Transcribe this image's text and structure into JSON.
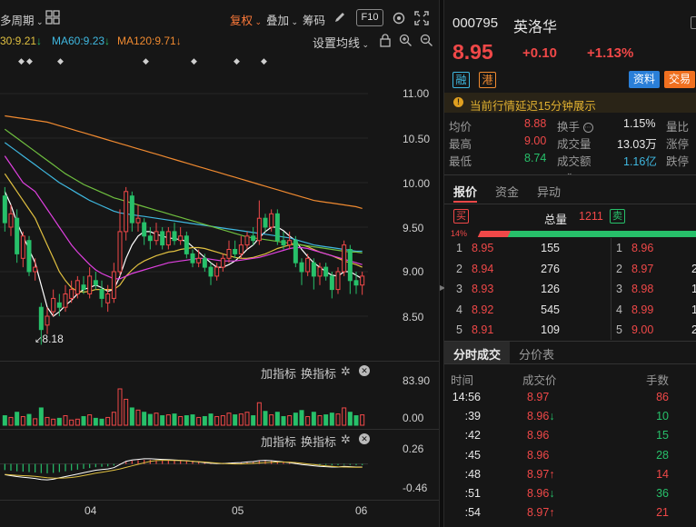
{
  "toolbar": {
    "period_label": "多周期",
    "fuquan_label": "复权",
    "overlay_label": "叠加",
    "chips_label": "筹码",
    "f10_label": "F10"
  },
  "ma_legend": [
    {
      "label": "30:9.21",
      "arrow": "↓",
      "color": "#e0c040"
    },
    {
      "label": "MA60:9.23",
      "arrow": "↓",
      "color": "#3fb8e0"
    },
    {
      "label": "MA120:9.71",
      "arrow": "↓",
      "color": "#f08a30"
    }
  ],
  "set_ma_label": "设置均线",
  "price_axis": [
    "11.00",
    "10.50",
    "10.00",
    "9.50",
    "9.00",
    "8.50"
  ],
  "low_marker": "8.18",
  "event_markers": [
    "◆",
    "◆",
    "◆",
    "◆",
    "◆",
    "◆",
    "◆"
  ],
  "volume_panel": {
    "add_label": "加指标",
    "swap_label": "换指标",
    "axis_top": "83.90",
    "axis_zero": "0.00"
  },
  "macd_panel": {
    "add_label": "加指标",
    "swap_label": "换指标",
    "axis_top": "0.26",
    "axis_bottom": "-0.46"
  },
  "date_axis": [
    "04",
    "05",
    "06"
  ],
  "stock": {
    "code": "000795",
    "name": "英洛华",
    "price": "8.95",
    "change": "+0.10",
    "change_pct": "+1.13%",
    "tag_rong": "融",
    "tag_gang": "港",
    "info_button": "资料",
    "trade_button": "交易",
    "notice": "当前行情延迟15分钟展示"
  },
  "stats": [
    {
      "label": "均价",
      "value": "8.88",
      "value_color": "red",
      "label2": "换手",
      "value2": "1.15%",
      "label3": "量比"
    },
    {
      "label": "最高",
      "value": "9.00",
      "value_color": "red",
      "label2": "成交量",
      "value2": "13.03万",
      "label3": "涨停"
    },
    {
      "label": "最低",
      "value": "8.74",
      "value_color": "green",
      "label2": "成交额",
      "value2": "1.16亿",
      "label3": "跌停"
    }
  ],
  "quote_tabs": [
    "报价",
    "资金",
    "异动"
  ],
  "orderbook": {
    "buy_tag": "买",
    "sell_tag": "卖",
    "total_label": "总量",
    "total_value": "1211",
    "buy_pct": "14%",
    "buy_ratio": 0.14,
    "bids": [
      {
        "level": "1",
        "price": "8.95",
        "volume": "155"
      },
      {
        "level": "2",
        "price": "8.94",
        "volume": "276"
      },
      {
        "level": "3",
        "price": "8.93",
        "volume": "126"
      },
      {
        "level": "4",
        "price": "8.92",
        "volume": "545"
      },
      {
        "level": "5",
        "price": "8.91",
        "volume": "109"
      }
    ],
    "asks": [
      {
        "level": "1",
        "price": "8.96",
        "volume": ""
      },
      {
        "level": "2",
        "price": "8.97",
        "volume": "2"
      },
      {
        "level": "3",
        "price": "8.98",
        "volume": "1"
      },
      {
        "level": "4",
        "price": "8.99",
        "volume": "1"
      },
      {
        "level": "5",
        "price": "9.00",
        "volume": "2"
      }
    ]
  },
  "trade_tabs": [
    "分时成交",
    "分价表"
  ],
  "trades_header": {
    "time": "时间",
    "price": "成交价",
    "volume": "手数"
  },
  "trades": [
    {
      "time": "14:56",
      "price": "8.97",
      "arrow": "",
      "volume": "86",
      "vol_color": "red"
    },
    {
      "time": ":39",
      "price": "8.96",
      "arrow": "↓",
      "volume": "10",
      "vol_color": "green"
    },
    {
      "time": ":42",
      "price": "8.96",
      "arrow": "",
      "volume": "15",
      "vol_color": "green"
    },
    {
      "time": ":45",
      "price": "8.96",
      "arrow": "",
      "volume": "28",
      "vol_color": "green"
    },
    {
      "time": ":48",
      "price": "8.97",
      "arrow": "↑",
      "volume": "14",
      "vol_color": "red"
    },
    {
      "time": ":51",
      "price": "8.96",
      "arrow": "↓",
      "volume": "36",
      "vol_color": "green"
    },
    {
      "time": ":54",
      "price": "8.97",
      "arrow": "↑",
      "volume": "21",
      "vol_color": "red"
    }
  ],
  "chart_data": {
    "type": "candlestick",
    "ylim": [
      8.0,
      11.3
    ],
    "candles": [
      [
        9.85,
        9.55,
        9.95,
        9.45
      ],
      [
        9.5,
        9.65,
        9.75,
        9.4
      ],
      [
        9.6,
        9.2,
        9.7,
        9.1
      ],
      [
        9.15,
        9.4,
        9.45,
        9.05
      ],
      [
        9.35,
        9.0,
        9.4,
        8.95
      ],
      [
        9.0,
        9.05,
        9.15,
        8.9
      ],
      [
        8.6,
        8.35,
        8.65,
        8.18
      ],
      [
        8.4,
        8.5,
        8.6,
        8.3
      ],
      [
        8.55,
        8.7,
        8.8,
        8.5
      ],
      [
        8.65,
        8.6,
        8.75,
        8.5
      ],
      [
        8.6,
        8.75,
        8.85,
        8.55
      ],
      [
        8.7,
        8.8,
        8.9,
        8.65
      ],
      [
        8.75,
        8.9,
        8.95,
        8.7
      ],
      [
        8.85,
        8.8,
        8.95,
        8.75
      ],
      [
        8.75,
        8.95,
        9.05,
        8.7
      ],
      [
        8.9,
        8.85,
        9.0,
        8.8
      ],
      [
        8.8,
        8.7,
        8.9,
        8.6
      ],
      [
        8.65,
        8.75,
        8.85,
        8.55
      ],
      [
        8.7,
        9.0,
        9.1,
        8.65
      ],
      [
        9.0,
        9.45,
        9.7,
        8.95
      ],
      [
        9.45,
        9.9,
        9.95,
        9.35
      ],
      [
        9.85,
        9.55,
        9.9,
        9.45
      ],
      [
        9.55,
        9.6,
        9.75,
        9.45
      ],
      [
        9.55,
        9.4,
        9.6,
        9.3
      ],
      [
        9.4,
        9.35,
        9.5,
        9.25
      ],
      [
        9.35,
        9.45,
        9.55,
        9.3
      ],
      [
        9.45,
        9.3,
        9.5,
        9.25
      ],
      [
        9.3,
        9.45,
        9.5,
        9.25
      ],
      [
        9.45,
        9.35,
        9.55,
        9.3
      ],
      [
        9.35,
        9.4,
        9.5,
        9.3
      ],
      [
        9.4,
        9.2,
        9.45,
        9.15
      ],
      [
        9.2,
        9.1,
        9.25,
        9.05
      ],
      [
        9.1,
        9.15,
        9.25,
        9.05
      ],
      [
        9.15,
        9.05,
        9.2,
        9.0
      ],
      [
        9.05,
        8.95,
        9.1,
        8.85
      ],
      [
        8.95,
        9.05,
        9.1,
        8.9
      ],
      [
        9.05,
        9.15,
        9.2,
        9.0
      ],
      [
        9.15,
        9.25,
        9.35,
        9.1
      ],
      [
        9.25,
        9.2,
        9.35,
        9.15
      ],
      [
        9.2,
        9.3,
        9.4,
        9.15
      ],
      [
        9.3,
        9.4,
        9.45,
        9.25
      ],
      [
        9.4,
        9.35,
        9.5,
        9.3
      ],
      [
        9.35,
        9.6,
        9.8,
        9.3
      ],
      [
        9.6,
        9.5,
        9.65,
        9.45
      ],
      [
        9.5,
        9.65,
        9.7,
        9.45
      ],
      [
        9.65,
        9.35,
        9.7,
        9.3
      ],
      [
        9.35,
        9.3,
        9.45,
        9.25
      ],
      [
        9.3,
        9.35,
        9.45,
        9.25
      ],
      [
        9.35,
        9.1,
        9.4,
        9.05
      ],
      [
        9.1,
        9.0,
        9.15,
        8.85
      ],
      [
        9.0,
        9.15,
        9.2,
        8.95
      ],
      [
        9.1,
        8.95,
        9.15,
        8.8
      ],
      [
        8.95,
        9.05,
        9.1,
        8.85
      ],
      [
        9.05,
        8.95,
        9.1,
        8.9
      ],
      [
        8.95,
        8.8,
        9.0,
        8.7
      ],
      [
        8.8,
        9.0,
        9.05,
        8.75
      ],
      [
        9.0,
        9.3,
        9.35,
        8.95
      ],
      [
        9.25,
        8.9,
        9.3,
        8.75
      ],
      [
        8.9,
        8.85,
        9.0,
        8.75
      ],
      [
        8.85,
        8.95,
        9.0,
        8.74
      ]
    ],
    "ma_lines": [
      {
        "color": "#ffffff",
        "values": [
          9.9,
          9.75,
          9.55,
          9.4,
          9.25,
          9.1,
          8.85,
          8.6,
          8.5,
          8.55,
          8.62,
          8.68,
          8.75,
          8.8,
          8.82,
          8.85,
          8.82,
          8.78,
          8.8,
          8.95,
          9.15,
          9.3,
          9.4,
          9.45,
          9.45,
          9.42,
          9.4,
          9.38,
          9.37,
          9.36,
          9.34,
          9.28,
          9.22,
          9.16,
          9.1,
          9.05,
          9.05,
          9.08,
          9.12,
          9.18,
          9.25,
          9.3,
          9.38,
          9.45,
          9.5,
          9.5,
          9.46,
          9.4,
          9.35,
          9.25,
          9.17,
          9.1,
          9.05,
          9.0,
          8.96,
          8.95,
          9.0,
          9.0,
          8.96,
          8.92
        ]
      },
      {
        "color": "#e0c040",
        "values": [
          10.1,
          10.0,
          9.9,
          9.8,
          9.7,
          9.6,
          9.45,
          9.3,
          9.15,
          9.0,
          8.9,
          8.82,
          8.78,
          8.77,
          8.78,
          8.8,
          8.8,
          8.8,
          8.8,
          8.85,
          8.95,
          9.02,
          9.08,
          9.12,
          9.15,
          9.18,
          9.2,
          9.22,
          9.23,
          9.25,
          9.26,
          9.27,
          9.27,
          9.26,
          9.24,
          9.22,
          9.2,
          9.18,
          9.16,
          9.15,
          9.15,
          9.16,
          9.18,
          9.2,
          9.23,
          9.26,
          9.28,
          9.3,
          9.31,
          9.3,
          9.28,
          9.25,
          9.22,
          9.2,
          9.18,
          9.15,
          9.12,
          9.1,
          9.08,
          9.05
        ]
      },
      {
        "color": "#e040e0",
        "values": [
          10.3,
          10.2,
          10.1,
          10.0,
          9.95,
          9.9,
          9.8,
          9.7,
          9.6,
          9.5,
          9.4,
          9.3,
          9.22,
          9.15,
          9.08,
          9.02,
          8.98,
          8.95,
          8.92,
          8.92,
          8.95,
          8.98,
          9.0,
          9.02,
          9.04,
          9.06,
          9.08,
          9.1,
          9.11,
          9.12,
          9.13,
          9.14,
          9.15,
          9.15,
          9.14,
          9.13,
          9.12,
          9.12,
          9.12,
          9.13,
          9.14,
          9.15,
          9.16,
          9.18,
          9.2,
          9.22,
          9.24,
          9.26,
          9.27,
          9.27,
          9.26,
          9.24,
          9.22,
          9.2,
          9.18,
          9.16,
          9.14,
          9.12,
          9.1,
          9.08
        ]
      },
      {
        "color": "#3fb8e0",
        "values": [
          10.45,
          10.4,
          10.35,
          10.3,
          10.25,
          10.2,
          10.15,
          10.1,
          10.05,
          10.0,
          9.96,
          9.92,
          9.88,
          9.84,
          9.8,
          9.77,
          9.74,
          9.71,
          9.68,
          9.66,
          9.65,
          9.64,
          9.63,
          9.62,
          9.61,
          9.6,
          9.59,
          9.58,
          9.57,
          9.56,
          9.55,
          9.54,
          9.53,
          9.52,
          9.51,
          9.5,
          9.49,
          9.48,
          9.47,
          9.46,
          9.45,
          9.44,
          9.43,
          9.42,
          9.41,
          9.4,
          9.39,
          9.38,
          9.36,
          9.34,
          9.32,
          9.3,
          9.29,
          9.28,
          9.27,
          9.26,
          9.25,
          9.24,
          9.23,
          9.23
        ]
      },
      {
        "color": "#6fbf3f",
        "values": [
          10.6,
          10.55,
          10.5,
          10.45,
          10.4,
          10.35,
          10.3,
          10.25,
          10.2,
          10.15,
          10.1,
          10.06,
          10.02,
          9.98,
          9.95,
          9.92,
          9.89,
          9.86,
          9.83,
          9.81,
          9.79,
          9.77,
          9.75,
          9.73,
          9.71,
          9.69,
          9.67,
          9.65,
          9.63,
          9.61,
          9.59,
          9.57,
          9.55,
          9.53,
          9.51,
          9.49,
          9.47,
          9.45,
          9.43,
          9.41,
          9.39,
          9.38,
          9.37,
          9.36,
          9.35,
          9.34,
          9.33,
          9.32,
          9.31,
          9.3,
          9.29,
          9.28,
          9.27,
          9.26,
          9.25,
          9.24,
          9.23,
          9.22,
          9.22,
          9.21
        ]
      },
      {
        "color": "#f08a30",
        "values": [
          10.75,
          10.74,
          10.73,
          10.72,
          10.71,
          10.7,
          10.69,
          10.68,
          10.66,
          10.64,
          10.62,
          10.6,
          10.58,
          10.56,
          10.54,
          10.52,
          10.5,
          10.48,
          10.46,
          10.44,
          10.42,
          10.4,
          10.38,
          10.36,
          10.34,
          10.32,
          10.3,
          10.28,
          10.26,
          10.24,
          10.22,
          10.2,
          10.18,
          10.16,
          10.14,
          10.12,
          10.1,
          10.08,
          10.06,
          10.04,
          10.02,
          10.0,
          9.98,
          9.96,
          9.94,
          9.92,
          9.9,
          9.88,
          9.86,
          9.84,
          9.82,
          9.8,
          9.79,
          9.78,
          9.77,
          9.76,
          9.75,
          9.74,
          9.73,
          9.71
        ]
      }
    ],
    "volumes": [
      22,
      18,
      30,
      20,
      25,
      15,
      40,
      18,
      14,
      16,
      22,
      12,
      14,
      20,
      24,
      16,
      14,
      18,
      30,
      84,
      60,
      40,
      35,
      30,
      25,
      28,
      22,
      24,
      26,
      20,
      22,
      24,
      18,
      20,
      26,
      20,
      22,
      28,
      24,
      26,
      30,
      22,
      52,
      32,
      24,
      30,
      20,
      22,
      28,
      34,
      20,
      30,
      22,
      24,
      28,
      26,
      40,
      30,
      22,
      24
    ],
    "macd": [
      -0.3,
      -0.33,
      -0.36,
      -0.38,
      -0.4,
      -0.42,
      -0.45,
      -0.46,
      -0.44,
      -0.4,
      -0.36,
      -0.32,
      -0.28,
      -0.24,
      -0.2,
      -0.16,
      -0.14,
      -0.12,
      -0.08,
      0.02,
      0.12,
      0.16,
      0.18,
      0.2,
      0.2,
      0.19,
      0.18,
      0.17,
      0.16,
      0.15,
      0.14,
      0.12,
      0.1,
      0.08,
      0.06,
      0.05,
      0.05,
      0.06,
      0.07,
      0.08,
      0.1,
      0.11,
      0.14,
      0.15,
      0.14,
      0.12,
      0.1,
      0.08,
      0.05,
      0.02,
      0.0,
      -0.02,
      -0.04,
      -0.05,
      -0.06,
      -0.06,
      -0.04,
      -0.05,
      -0.06,
      -0.06
    ],
    "dates": [
      "04",
      "05",
      "06"
    ]
  }
}
